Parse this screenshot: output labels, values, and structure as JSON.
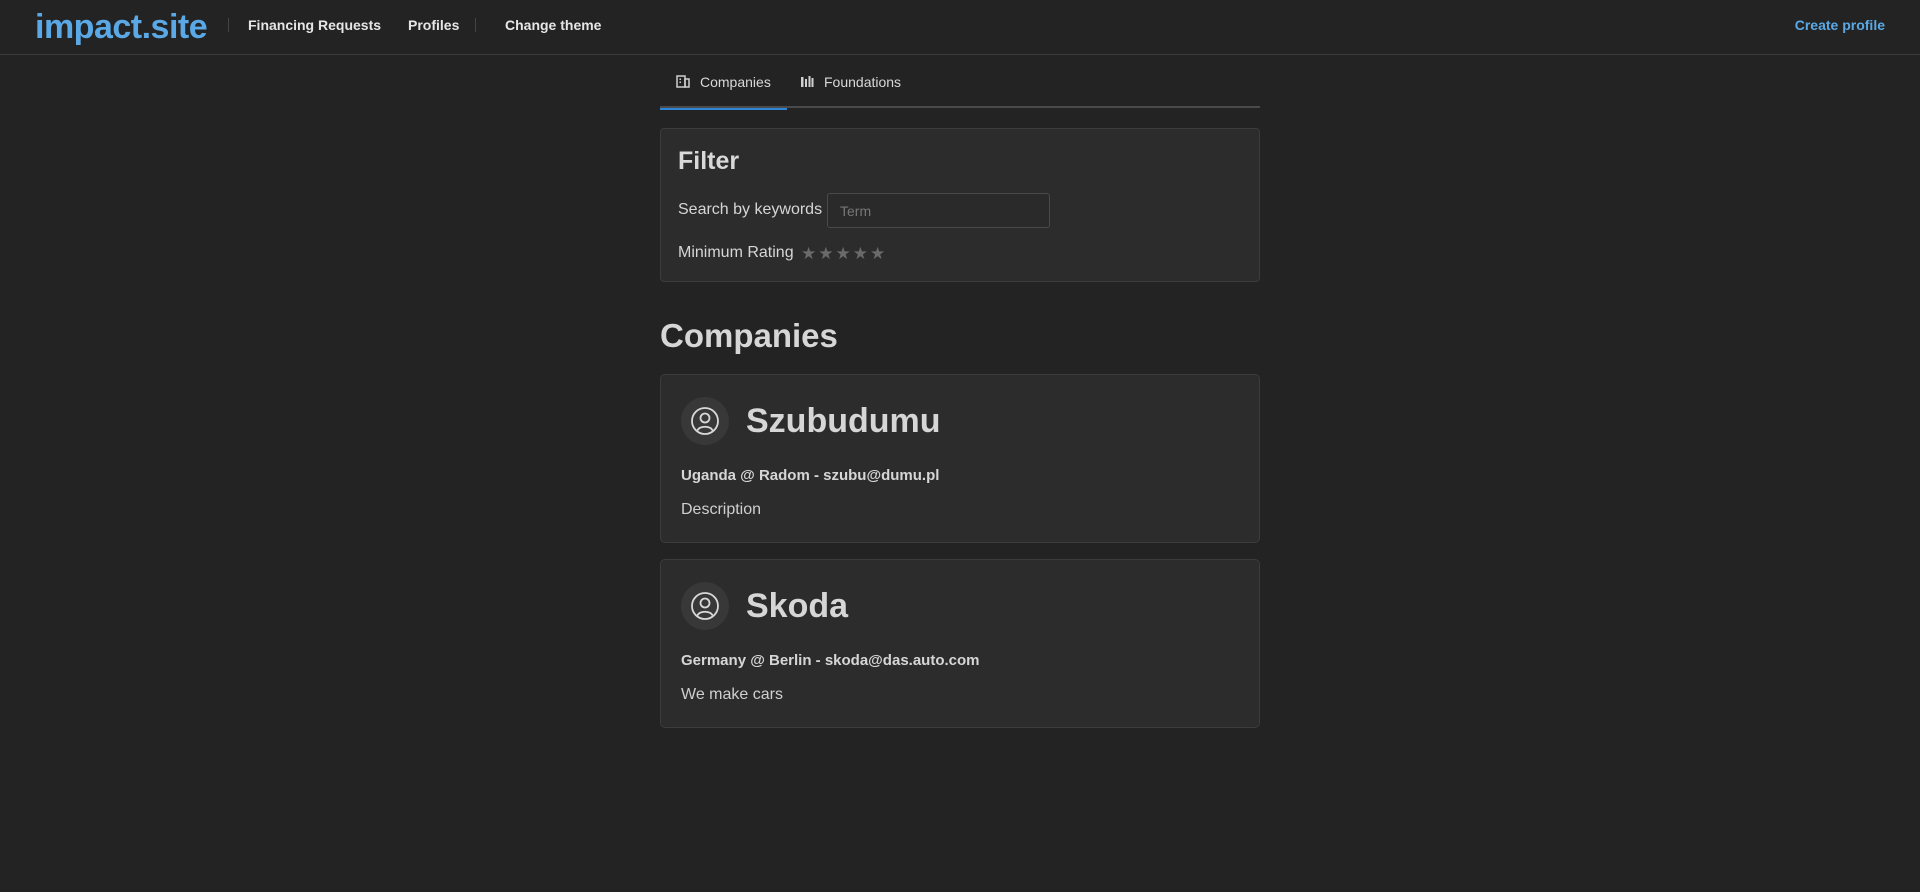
{
  "header": {
    "brand": "impact.site",
    "nav": [
      {
        "label": "Financing Requests"
      },
      {
        "label": "Profiles"
      },
      {
        "label": "Change theme"
      }
    ],
    "create_profile": "Create profile"
  },
  "tabs": [
    {
      "label": "Companies",
      "icon": "building-icon",
      "active": true
    },
    {
      "label": "Foundations",
      "icon": "columns-icon",
      "active": false
    }
  ],
  "filter": {
    "title": "Filter",
    "search_label": "Search by keywords",
    "search_placeholder": "Term",
    "search_value": "",
    "rating_label": "Minimum Rating",
    "rating_value": 0,
    "rating_max": 5
  },
  "section_title": "Companies",
  "companies": [
    {
      "name": "Szubudumu",
      "meta": "Uganda @ Radom - szubu@dumu.pl",
      "description": "Description"
    },
    {
      "name": "Skoda",
      "meta": "Germany @ Berlin - skoda@das.auto.com",
      "description": "We make cars"
    }
  ],
  "colors": {
    "background": "#232323",
    "card": "#2c2c2c",
    "accent": "#5aa9e6",
    "tab_active": "#2f86d6"
  }
}
